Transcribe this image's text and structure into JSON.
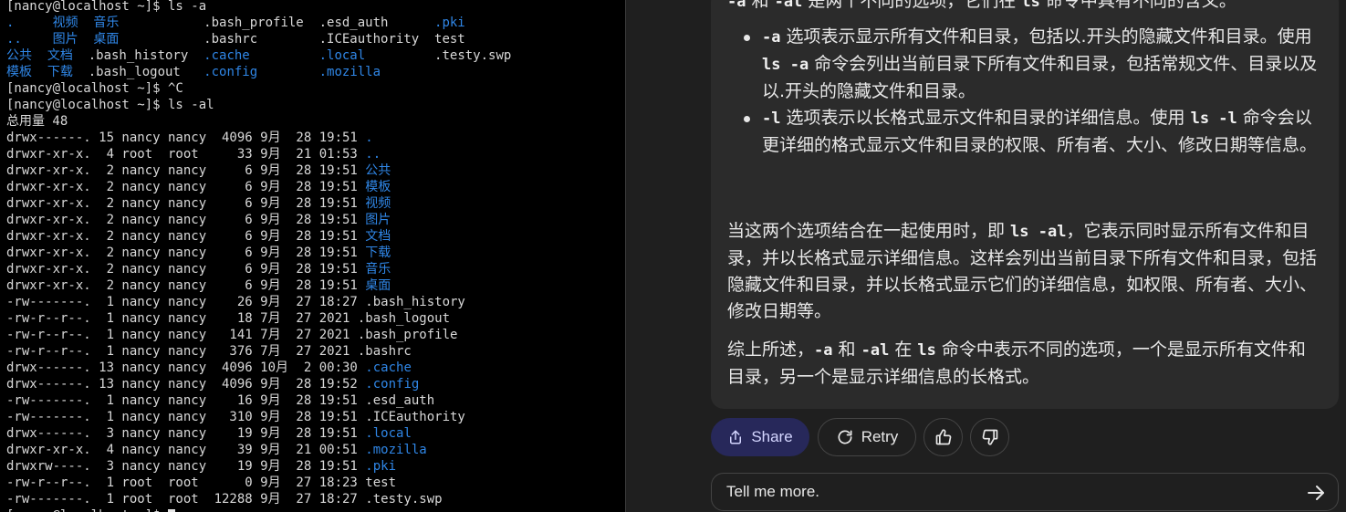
{
  "terminal": {
    "colors": {
      "default": "#d8d8d8",
      "dir": "#2f86e6",
      "background": "#000000"
    },
    "lines": [
      [
        {
          "t": "[nancy@localhost ~]$ ls -a",
          "c": "default"
        }
      ],
      [
        {
          "t": ".     ",
          "c": "dir"
        },
        {
          "t": "视频  音乐",
          "c": "dir"
        },
        {
          "t": "           .bash_profile  .esd_auth      ",
          "c": "default"
        },
        {
          "t": ".pki",
          "c": "dir"
        }
      ],
      [
        {
          "t": "..    ",
          "c": "dir"
        },
        {
          "t": "图片  桌面",
          "c": "dir"
        },
        {
          "t": "           .bashrc        .ICEauthority  test",
          "c": "default"
        }
      ],
      [
        {
          "t": "公共  文档",
          "c": "dir"
        },
        {
          "t": "  .bash_history  ",
          "c": "default"
        },
        {
          "t": ".cache",
          "c": "dir"
        },
        {
          "t": "         ",
          "c": "default"
        },
        {
          "t": ".local",
          "c": "dir"
        },
        {
          "t": "         .testy.swp",
          "c": "default"
        }
      ],
      [
        {
          "t": "模板  下载",
          "c": "dir"
        },
        {
          "t": "  .bash_logout   ",
          "c": "default"
        },
        {
          "t": ".config",
          "c": "dir"
        },
        {
          "t": "        ",
          "c": "default"
        },
        {
          "t": ".mozilla",
          "c": "dir"
        }
      ],
      [
        {
          "t": "[nancy@localhost ~]$ ^C",
          "c": "default"
        }
      ],
      [
        {
          "t": "[nancy@localhost ~]$ ls -al",
          "c": "default"
        }
      ],
      [
        {
          "t": "总用量 48",
          "c": "default"
        }
      ],
      [
        {
          "t": "drwx------. 15 nancy nancy  4096 9月  28 19:51 ",
          "c": "default"
        },
        {
          "t": ".",
          "c": "dir"
        }
      ],
      [
        {
          "t": "drwxr-xr-x.  4 root  root     33 9月  21 01:53 ",
          "c": "default"
        },
        {
          "t": "..",
          "c": "dir"
        }
      ],
      [
        {
          "t": "drwxr-xr-x.  2 nancy nancy     6 9月  28 19:51 ",
          "c": "default"
        },
        {
          "t": "公共",
          "c": "dir"
        }
      ],
      [
        {
          "t": "drwxr-xr-x.  2 nancy nancy     6 9月  28 19:51 ",
          "c": "default"
        },
        {
          "t": "模板",
          "c": "dir"
        }
      ],
      [
        {
          "t": "drwxr-xr-x.  2 nancy nancy     6 9月  28 19:51 ",
          "c": "default"
        },
        {
          "t": "视频",
          "c": "dir"
        }
      ],
      [
        {
          "t": "drwxr-xr-x.  2 nancy nancy     6 9月  28 19:51 ",
          "c": "default"
        },
        {
          "t": "图片",
          "c": "dir"
        }
      ],
      [
        {
          "t": "drwxr-xr-x.  2 nancy nancy     6 9月  28 19:51 ",
          "c": "default"
        },
        {
          "t": "文档",
          "c": "dir"
        }
      ],
      [
        {
          "t": "drwxr-xr-x.  2 nancy nancy     6 9月  28 19:51 ",
          "c": "default"
        },
        {
          "t": "下载",
          "c": "dir"
        }
      ],
      [
        {
          "t": "drwxr-xr-x.  2 nancy nancy     6 9月  28 19:51 ",
          "c": "default"
        },
        {
          "t": "音乐",
          "c": "dir"
        }
      ],
      [
        {
          "t": "drwxr-xr-x.  2 nancy nancy     6 9月  28 19:51 ",
          "c": "default"
        },
        {
          "t": "桌面",
          "c": "dir"
        }
      ],
      [
        {
          "t": "-rw-------.  1 nancy nancy    26 9月  27 18:27 .bash_history",
          "c": "default"
        }
      ],
      [
        {
          "t": "-rw-r--r--.  1 nancy nancy    18 7月  27 2021 .bash_logout",
          "c": "default"
        }
      ],
      [
        {
          "t": "-rw-r--r--.  1 nancy nancy   141 7月  27 2021 .bash_profile",
          "c": "default"
        }
      ],
      [
        {
          "t": "-rw-r--r--.  1 nancy nancy   376 7月  27 2021 .bashrc",
          "c": "default"
        }
      ],
      [
        {
          "t": "drwx------. 13 nancy nancy  4096 10月  2 00:30 ",
          "c": "default"
        },
        {
          "t": ".cache",
          "c": "dir"
        }
      ],
      [
        {
          "t": "drwx------. 13 nancy nancy  4096 9月  28 19:52 ",
          "c": "default"
        },
        {
          "t": ".config",
          "c": "dir"
        }
      ],
      [
        {
          "t": "-rw-------.  1 nancy nancy    16 9月  28 19:51 .esd_auth",
          "c": "default"
        }
      ],
      [
        {
          "t": "-rw-------.  1 nancy nancy   310 9月  28 19:51 .ICEauthority",
          "c": "default"
        }
      ],
      [
        {
          "t": "drwx------.  3 nancy nancy    19 9月  28 19:51 ",
          "c": "default"
        },
        {
          "t": ".local",
          "c": "dir"
        }
      ],
      [
        {
          "t": "drwxr-xr-x.  4 nancy nancy    39 9月  21 00:51 ",
          "c": "default"
        },
        {
          "t": ".mozilla",
          "c": "dir"
        }
      ],
      [
        {
          "t": "drwxrw----.  3 nancy nancy    19 9月  28 19:51 ",
          "c": "default"
        },
        {
          "t": ".pki",
          "c": "dir"
        }
      ],
      [
        {
          "t": "-rw-r--r--.  1 root  root      0 9月  27 18:23 test",
          "c": "default"
        }
      ],
      [
        {
          "t": "-rw-------.  1 root  root  12288 9月  27 18:27 .testy.swp",
          "c": "default"
        }
      ],
      [
        {
          "t": "[nancy@localhost ~]$ ",
          "c": "default"
        }
      ]
    ]
  },
  "answer": {
    "p0": [
      {
        "t": "-a",
        "code": true
      },
      {
        "t": " 和 "
      },
      {
        "t": "-al",
        "code": true
      },
      {
        "t": " 是两个不同的选项，它们在 "
      },
      {
        "t": "ls",
        "code": true
      },
      {
        "t": " 命令中具有不同的含义。"
      }
    ],
    "bullets": [
      [
        {
          "t": "-a",
          "code": true
        },
        {
          "t": " 选项表示显示所有文件和目录，包括以.开头的隐藏文件和目录。使用 "
        },
        {
          "t": "ls -a",
          "code": true
        },
        {
          "t": " 命令会列出当前目录下所有文件和目录，包括常规文件、目录以及以.开头的隐藏文件和目录。"
        }
      ],
      [
        {
          "t": "-l",
          "code": true
        },
        {
          "t": " 选项表示以长格式显示文件和目录的详细信息。使用 "
        },
        {
          "t": "ls -l",
          "code": true
        },
        {
          "t": " 命令会以更详细的格式显示文件和目录的权限、所有者、大小、修改日期等信息。"
        }
      ]
    ],
    "p2": [
      {
        "t": "当这两个选项结合在一起使用时，即 "
      },
      {
        "t": "ls -al",
        "code": true
      },
      {
        "t": "，它表示同时显示所有文件和目录，并以长格式显示详细信息。这样会列出当前目录下所有文件和目录，包括隐藏文件和目录，并以长格式显示它们的详细信息，如权限、所有者、大小、修改日期等。"
      }
    ],
    "p3": [
      {
        "t": "综上所述，"
      },
      {
        "t": "-a",
        "code": true
      },
      {
        "t": " 和 "
      },
      {
        "t": "-al",
        "code": true
      },
      {
        "t": " 在 "
      },
      {
        "t": "ls",
        "code": true
      },
      {
        "t": " 命令中表示不同的选项，一个是显示所有文件和目录，另一个是显示详细信息的长格式。"
      }
    ]
  },
  "actions": {
    "share_label": "Share",
    "retry_label": "Retry",
    "share_icon": "share-icon",
    "retry_icon": "retry-icon",
    "like_icon": "thumbs-up-icon",
    "dislike_icon": "thumbs-down-icon"
  },
  "input": {
    "value": "Tell me more.",
    "send_icon": "arrow-right-icon"
  },
  "colors": {
    "share_bg": "#27285a",
    "share_fg": "#d4d6ff",
    "card_bg": "#2b2b2b",
    "page_bg": "#1f1f1f"
  }
}
